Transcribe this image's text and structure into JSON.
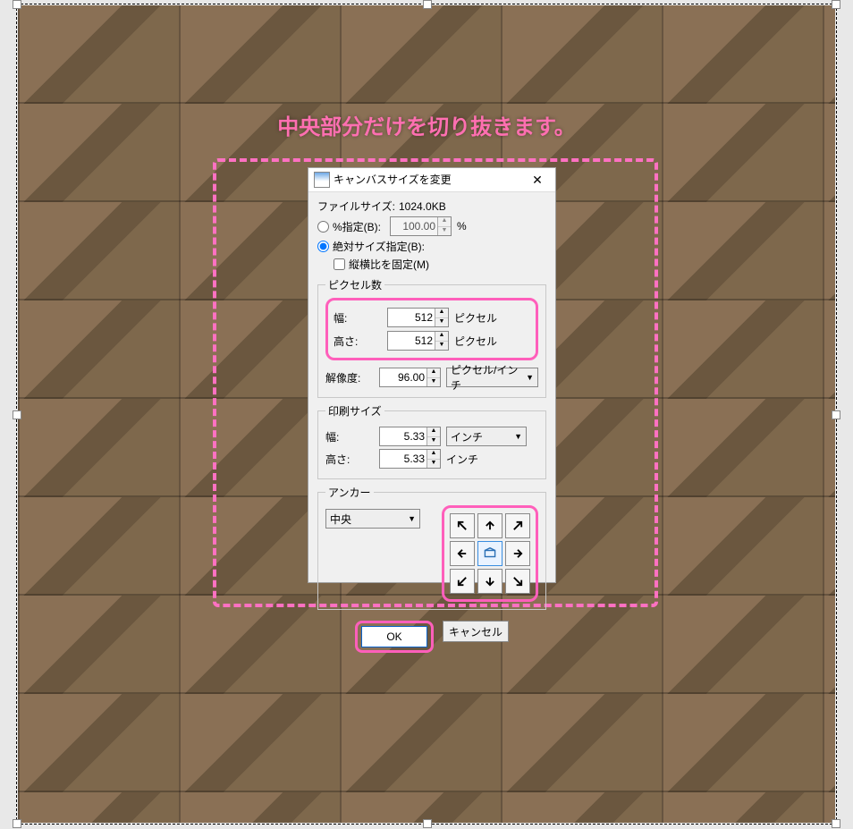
{
  "annotation": "中央部分だけを切り抜きます。",
  "dialog": {
    "title": "キャンバスサイズを変更",
    "filesize_label": "ファイルサイズ:",
    "filesize_value": "1024.0KB",
    "percent_label": "%指定(B):",
    "percent_value": "100.00",
    "percent_unit": "%",
    "absolute_label": "絶対サイズ指定(B):",
    "lock_ratio": "縦横比を固定(M)",
    "pixel_group": "ピクセル数",
    "width_label": "幅:",
    "width_value": "512",
    "height_label": "高さ:",
    "height_value": "512",
    "pixel_unit": "ピクセル",
    "resolution_label": "解像度:",
    "resolution_value": "96.00",
    "resolution_unit": "ピクセル/インチ",
    "print_group": "印刷サイズ",
    "print_width_value": "5.33",
    "print_height_value": "5.33",
    "print_unit": "インチ",
    "anchor_group": "アンカー",
    "anchor_value": "中央",
    "ok": "OK",
    "cancel": "キャンセル"
  }
}
